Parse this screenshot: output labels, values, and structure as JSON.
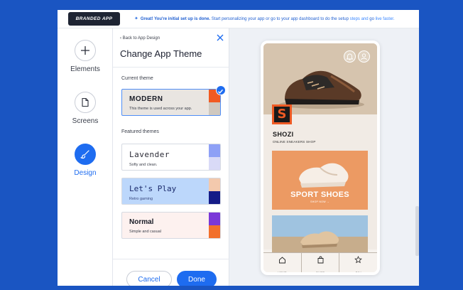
{
  "topbar": {
    "badge": "BRANDED APP",
    "banner_bold": "Great! You're initial set up is done.",
    "banner_text": " Start personalizing your app or go to your app dashboard to do the setup ",
    "banner_link1": "steps and",
    "banner_mid": " go ",
    "banner_link2": "live faster."
  },
  "rail": {
    "items": [
      {
        "label": "Elements",
        "icon": "plus-icon"
      },
      {
        "label": "Screens",
        "icon": "page-icon"
      },
      {
        "label": "Design",
        "icon": "brush-icon",
        "active": true
      }
    ]
  },
  "panel": {
    "back_label": "Back to App Design",
    "title": "Change App Theme",
    "current_label": "Current theme",
    "current_theme": {
      "name": "MODERN",
      "sub": "This theme is used across your app.",
      "colors": [
        "#f15a22",
        "#cfc8bf"
      ]
    },
    "featured_label": "Featured themes",
    "featured": [
      {
        "name": "Lavender",
        "sub": "Softy and clean.",
        "bg": "#ffffff",
        "colors": [
          "#8ea0f6",
          "#d9daf7"
        ]
      },
      {
        "name": "Let's Play",
        "sub": "Retro gaming",
        "bg": "#bcd7fb",
        "colors": [
          "#f3c9ad",
          "#141b87"
        ]
      },
      {
        "name": "Normal",
        "sub": "Simple and casual",
        "bg": "#fdf1ef",
        "colors": [
          "#7a38d8",
          "#f2702c"
        ]
      }
    ],
    "cancel_label": "Cancel",
    "done_label": "Done"
  },
  "preview": {
    "brand": "SHOZI",
    "brand_sub": "ONLINE SNEAKERS SHOP",
    "logo_letter": "S",
    "promo_title": "SPORT SHOES",
    "promo_sub": "SHOP NOW →",
    "tabs": [
      {
        "label": "HOME",
        "icon": "home-icon"
      },
      {
        "label": "SHOP",
        "icon": "bag-icon"
      },
      {
        "label": "FAV",
        "icon": "star-icon"
      }
    ]
  },
  "colors": {
    "accent": "#1e6cf0",
    "page_bg": "#1a55c2",
    "brand_orange": "#ee5a24"
  }
}
